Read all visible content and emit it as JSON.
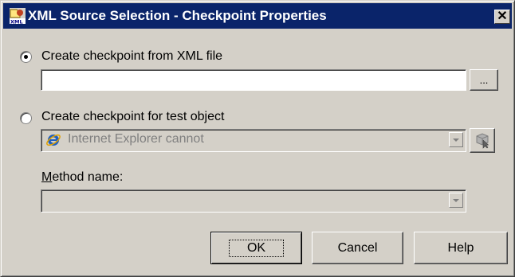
{
  "window": {
    "title": "XML Source Selection - Checkpoint Properties",
    "close_glyph": "✕",
    "icon": "xml-icon"
  },
  "option_file": {
    "label": "Create checkpoint from XML file",
    "selected": true,
    "path_value": "",
    "browse_label": "..."
  },
  "option_object": {
    "label": "Create checkpoint for test object",
    "selected": false,
    "object_value": "Internet Explorer cannot",
    "object_icon": "internet-explorer-icon",
    "pointer_icon": "object-pointer-icon"
  },
  "method": {
    "label_mnemonic": "M",
    "label_rest": "ethod name:",
    "value": ""
  },
  "buttons": {
    "ok": "OK",
    "cancel": "Cancel",
    "help": "Help"
  },
  "colors": {
    "titlebar": "#0a246a",
    "face": "#d4d0c8",
    "disabled_text": "#808080"
  }
}
